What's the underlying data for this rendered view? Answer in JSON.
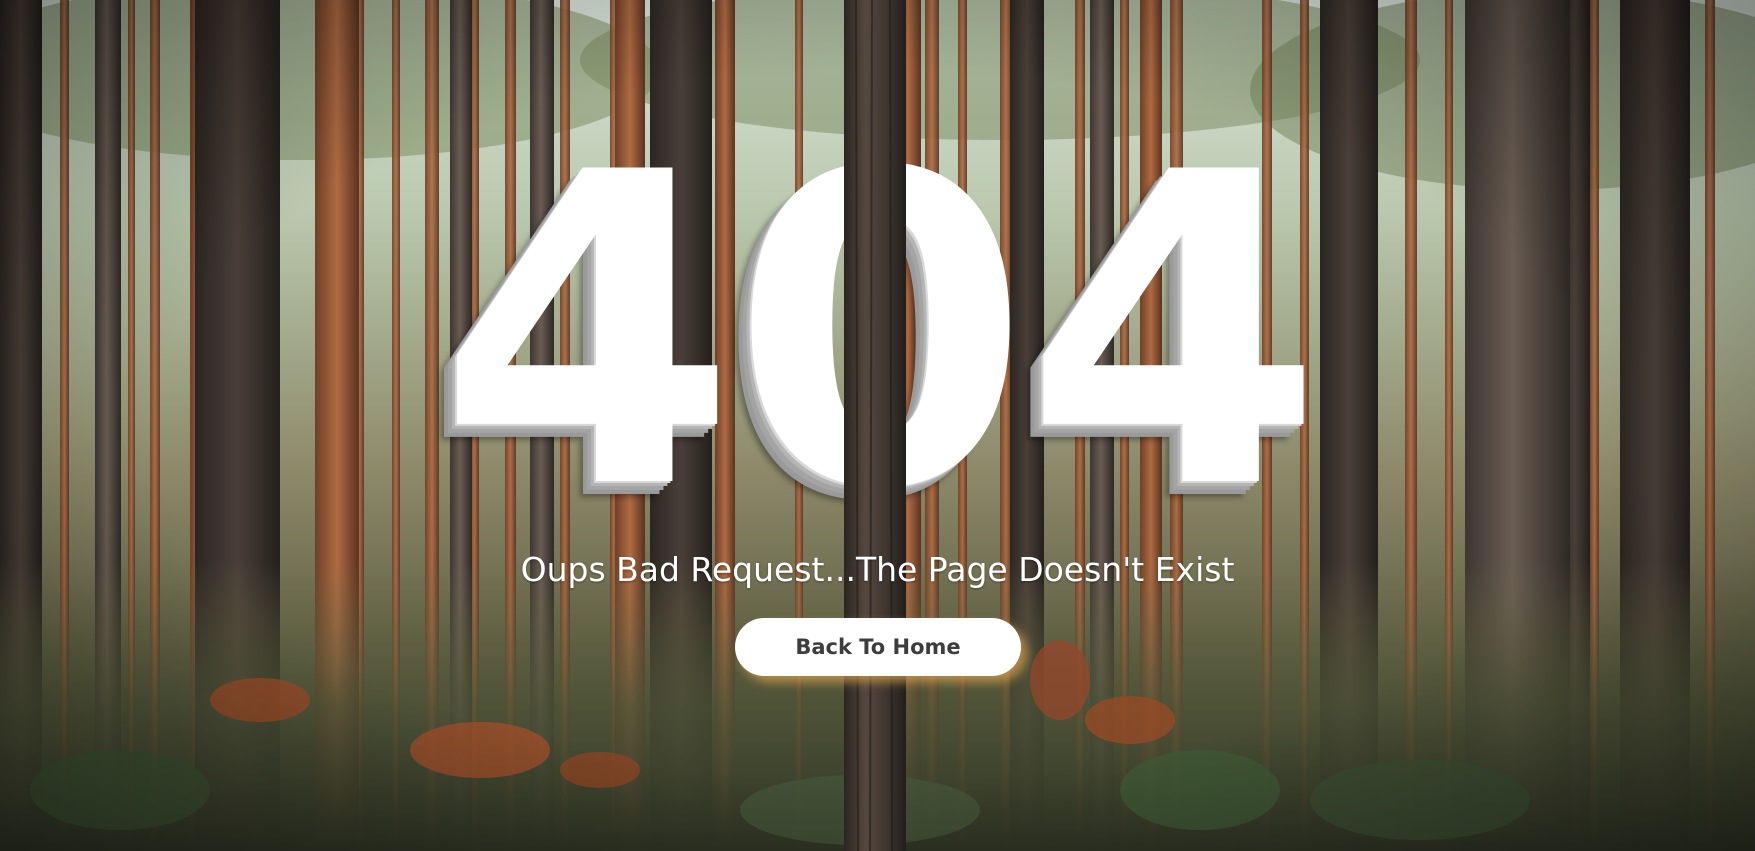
{
  "error_page": {
    "code": "404",
    "message": "Oups Bad Request...The Page Doesn't Exist",
    "button_label": "Back To Home"
  },
  "colors": {
    "code_text": "#ffffff",
    "code_shadow": "#a4a4a4",
    "button_bg": "#ffffff",
    "button_text": "#3d3d3d",
    "button_glow": "#d6a050"
  },
  "background": {
    "icon": "forest-photo"
  }
}
